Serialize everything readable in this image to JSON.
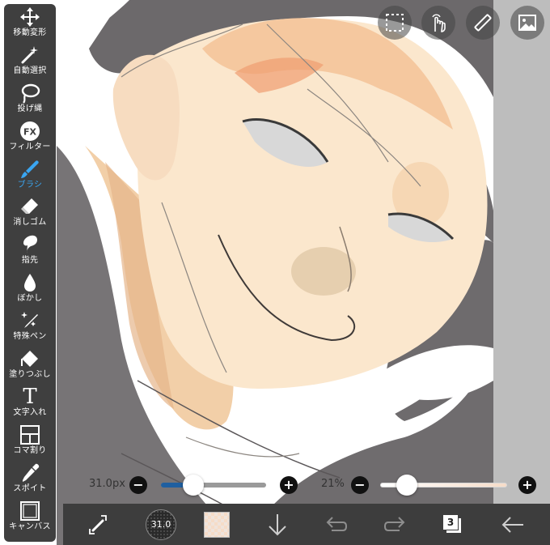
{
  "tools": [
    {
      "label": "移動変形",
      "icon": "move-arrows-icon",
      "active": false
    },
    {
      "label": "自動選択",
      "icon": "magic-wand-icon",
      "active": false
    },
    {
      "label": "投げ縄",
      "icon": "lasso-icon",
      "active": false
    },
    {
      "label": "フィルター",
      "icon": "fx-filter-icon",
      "active": false
    },
    {
      "label": "ブラシ",
      "icon": "brush-icon",
      "active": true
    },
    {
      "label": "消しゴム",
      "icon": "eraser-icon",
      "active": false
    },
    {
      "label": "指先",
      "icon": "smudge-finger-icon",
      "active": false
    },
    {
      "label": "ぼかし",
      "icon": "blur-drop-icon",
      "active": false
    },
    {
      "label": "特殊ペン",
      "icon": "special-pen-icon",
      "active": false
    },
    {
      "label": "塗りつぶし",
      "icon": "bucket-fill-icon",
      "active": false
    },
    {
      "label": "文字入れ",
      "icon": "text-t-icon",
      "active": false
    },
    {
      "label": "コマ割り",
      "icon": "frame-divider-icon",
      "active": false
    },
    {
      "label": "スポイト",
      "icon": "eyedropper-icon",
      "active": false
    },
    {
      "label": "キャンバス",
      "icon": "canvas-icon",
      "active": false
    }
  ],
  "filter_glyph": "FX",
  "text_glyph": "T",
  "brush_size": {
    "label": "31.0px",
    "value": 31.0,
    "fraction": 0.31
  },
  "opacity": {
    "label": "21%",
    "value": 21,
    "fraction": 0.21
  },
  "brush_preview_label": "31.0",
  "layer_count": "3",
  "colors": {
    "accent": "#3aa6f2",
    "toolbar_bg": "#3f3f3f",
    "current_color": "#f6dcc8",
    "size_track_fill": "#1f5fa0"
  },
  "top_buttons": [
    "selection-icon",
    "hand-gesture-icon",
    "ruler-icon",
    "image-icon"
  ],
  "bottom_buttons": [
    "transform-swap-icon",
    "brush-preview",
    "color-swatch",
    "arrow-down-icon",
    "undo-icon",
    "redo-icon",
    "layers-icon",
    "back-arrow-icon"
  ]
}
